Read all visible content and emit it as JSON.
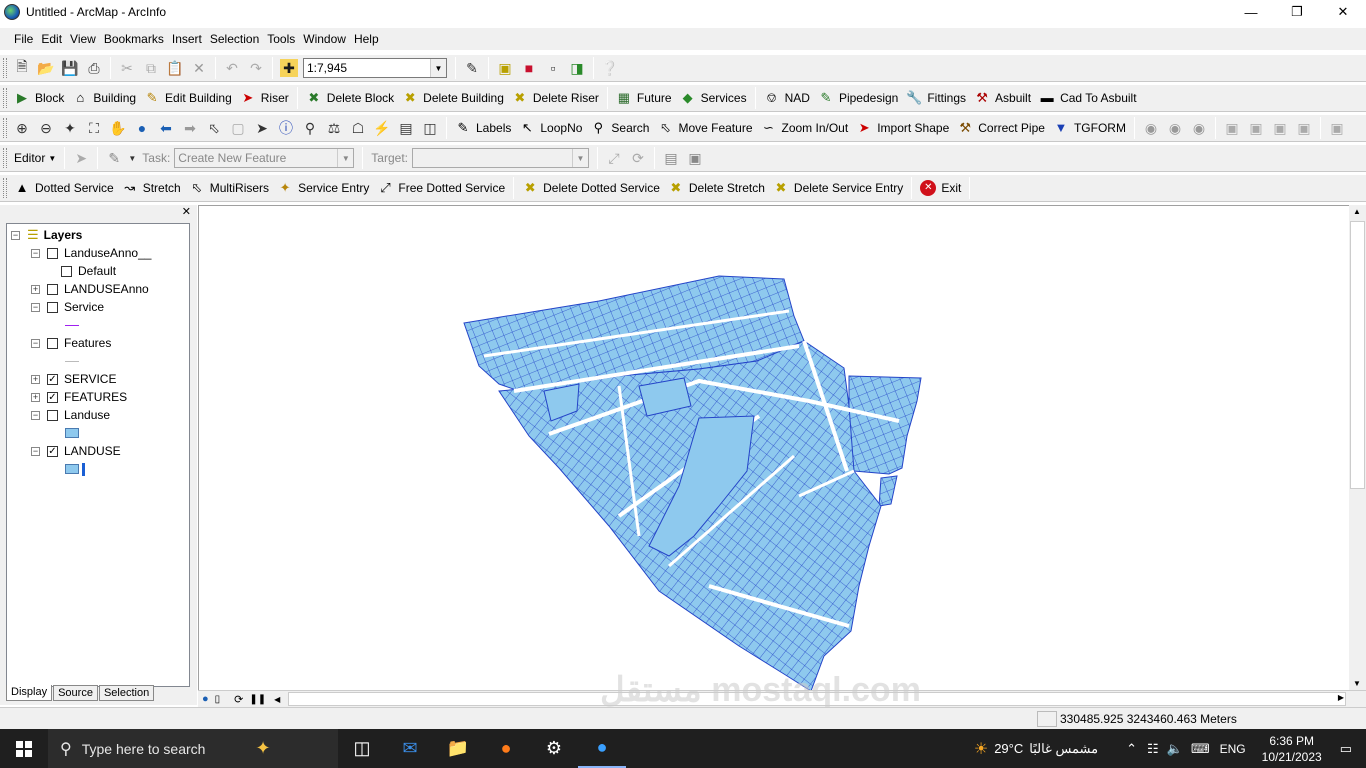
{
  "window": {
    "title": "Untitled - ArcMap - ArcInfo"
  },
  "menus": [
    "File",
    "Edit",
    "View",
    "Bookmarks",
    "Insert",
    "Selection",
    "Tools",
    "Window",
    "Help"
  ],
  "standard_toolbar": {
    "scale": "1:7,945"
  },
  "custom_toolbar_1": [
    "Block",
    "Building",
    "Edit Building",
    "Riser",
    "Delete Block",
    "Delete Building",
    "Delete Riser",
    "Future",
    "Services",
    "NAD",
    "Pipedesign",
    "Fittings",
    "Asbuilt",
    "Cad To Asbuilt"
  ],
  "tools_toolbar": [
    "Labels",
    "LoopNo",
    "Search",
    "Move Feature",
    "Zoom In/Out",
    "Import Shape",
    "Correct Pipe",
    "TGFORM"
  ],
  "editor": {
    "menu": "Editor",
    "task_label": "Task:",
    "task_value": "Create New Feature",
    "target_label": "Target:",
    "target_value": ""
  },
  "custom_toolbar_2": [
    "Dotted Service",
    "Stretch",
    "MultiRisers",
    "Service Entry",
    "Free Dotted Service",
    "Delete Dotted Service",
    "Delete Stretch",
    "Delete Service Entry",
    "Exit"
  ],
  "toc": {
    "root": "Layers",
    "layers": [
      {
        "name": "LandusеAnno__",
        "label": "LanduseAnno__",
        "checked": false,
        "expanded": true
      },
      {
        "name": "Default",
        "checked": false
      },
      {
        "name": "LANDUSEAnno",
        "checked": false,
        "expanded": false
      },
      {
        "name": "Service",
        "checked": false,
        "expanded": true
      },
      {
        "name": "Features",
        "checked": false,
        "expanded": true
      },
      {
        "name": "SERVICE",
        "checked": true,
        "expanded": false
      },
      {
        "name": "FEATURES",
        "checked": true,
        "expanded": false
      },
      {
        "name": "Landuse",
        "checked": false,
        "expanded": true
      },
      {
        "name": "LANDUSE",
        "checked": true,
        "expanded": true
      }
    ],
    "tabs": [
      "Display",
      "Source",
      "Selection"
    ]
  },
  "status": {
    "coordinates": "330485.925  3243460.463 Meters"
  },
  "taskbar": {
    "search_placeholder": "Type here to search",
    "weather": "29°C",
    "weather_text": "مشمس غالبًا",
    "language": "ENG",
    "time": "6:36 PM",
    "date": "10/21/2023"
  },
  "watermark": "مستقل mostaql.com",
  "colors": {
    "parcel_fill": "#8ec9ee",
    "parcel_stroke": "#1f3fcf"
  }
}
